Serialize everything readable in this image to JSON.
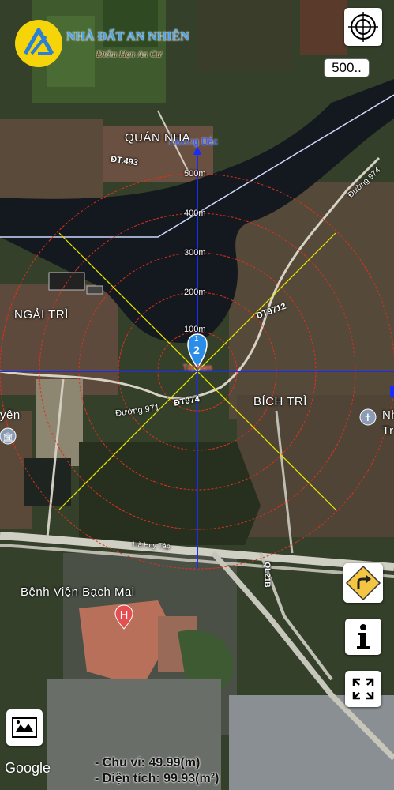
{
  "logo": {
    "title": "NHÀ ĐẤT AN NHIÊN",
    "subtitle": "Điểm Hẹn An Cư"
  },
  "controls": {
    "scale_value": "500..",
    "gps_icon": "crosshair-target-icon",
    "direction_icon": "turn-right-sign-icon",
    "info_icon": "info-icon",
    "fullscreen_icon": "expand-arrows-icon",
    "layers_icon": "map-layers-icon"
  },
  "overlay": {
    "north_label": "Hướng Bắc",
    "rings": [
      "500m",
      "400m",
      "300m",
      "200m",
      "100m"
    ],
    "marker": {
      "top": "1",
      "bottom": "2"
    },
    "point_label": "Tây Nam",
    "ring_color": "#e0301e",
    "crosshair_color": "#1a2bff",
    "diagonal_color": "#e8e800"
  },
  "places": {
    "quan_nha": "QUÁN NHA",
    "ngai_tri": "NGẢI TRÌ",
    "bich_tri": "BÍCH TRÌ",
    "benh_vien": "Bệnh Viện Bạch Mai",
    "left_edge": "yên",
    "right_edge_1": "Nh",
    "right_edge_2": "Tr"
  },
  "roads": {
    "dt493": "ĐT.493",
    "duong974": "Đường 974",
    "dt9712": "DT9712",
    "duong971": "Đường 971",
    "dt974": "ĐT974",
    "ha_huy_tap": "Hà Huy Tập",
    "ql21b": "QL21B"
  },
  "footer": {
    "google": "Google",
    "perimeter": "- Chu vi: 49.99(m)",
    "area": "- Diện tích: 99.93(m²)"
  }
}
